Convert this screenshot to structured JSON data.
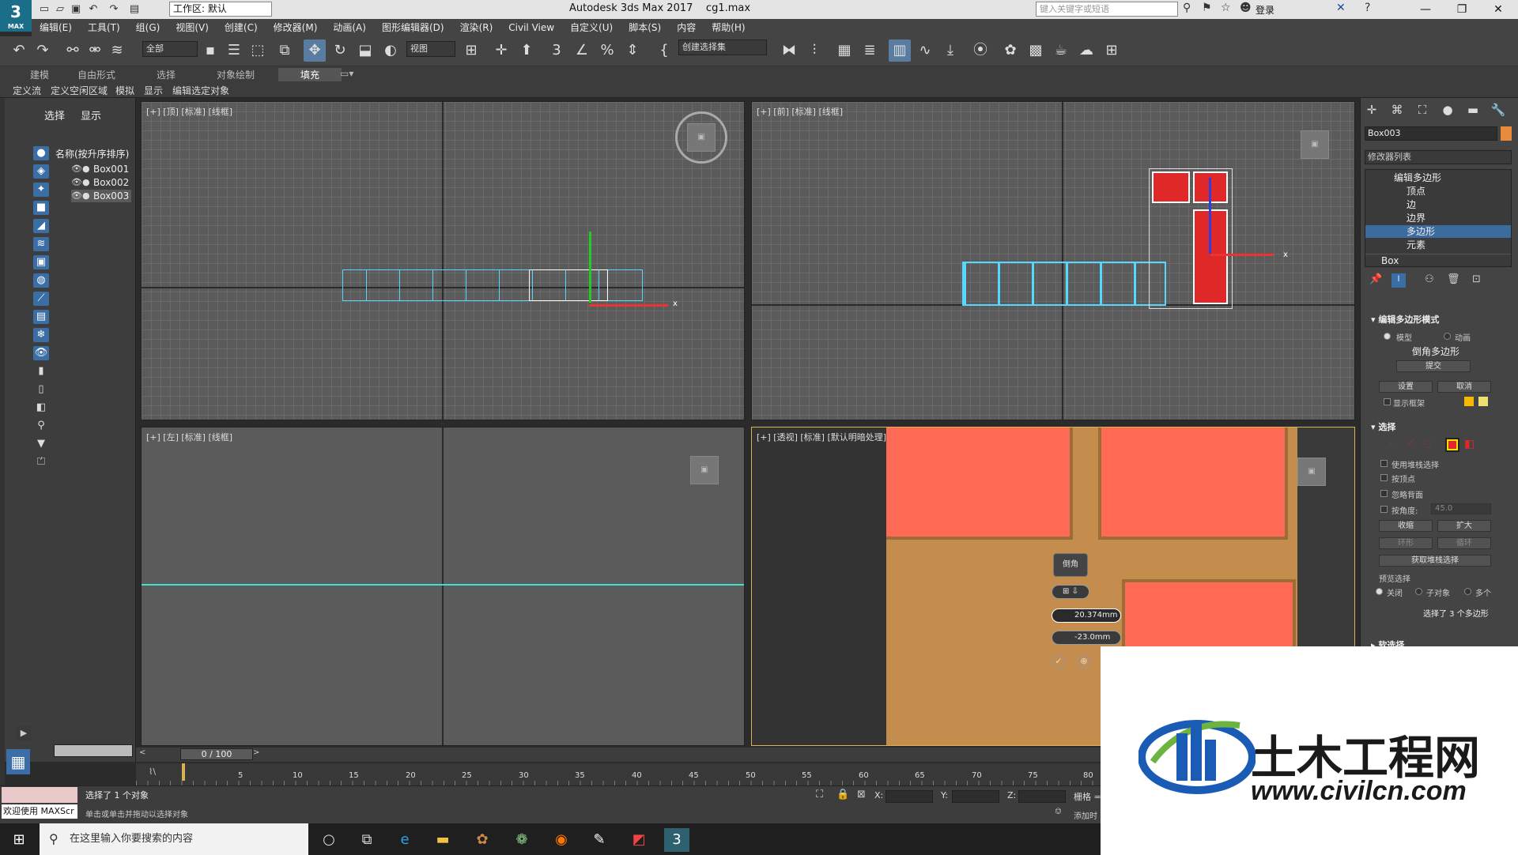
{
  "titlebar": {
    "logo": "3",
    "logo_sub": "MAX",
    "workspace": "工作区: 默认",
    "app": "Autodesk 3ds Max 2017",
    "file": "cg1.max",
    "search_placeholder": "键入关键字或短语",
    "login": "登录"
  },
  "menu": [
    "编辑(E)",
    "工具(T)",
    "组(G)",
    "视图(V)",
    "创建(C)",
    "修改器(M)",
    "动画(A)",
    "图形编辑器(D)",
    "渲染(R)",
    "Civil View",
    "自定义(U)",
    "脚本(S)",
    "内容",
    "帮助(H)"
  ],
  "toolbar": {
    "filter": "全部",
    "refcoord": "视图",
    "selset": "创建选择集"
  },
  "ribbon": {
    "tabs": [
      "建模",
      "自由形式",
      "选择",
      "对象绘制",
      "填充"
    ],
    "subtabs": [
      "定义流",
      "定义空闲区域",
      "模拟",
      "显示",
      "编辑选定对象"
    ]
  },
  "explorer": {
    "tabs": [
      "选择",
      "显示"
    ],
    "header": "名称(按升序排序)",
    "items": [
      "Box001",
      "Box002",
      "Box003"
    ]
  },
  "viewports": {
    "top": "[+] [顶] [标准] [线框]",
    "front": "[+] [前] [标准] [线框]",
    "left": "[+] [左] [标准] [线框]",
    "persp": "[+] [透视] [标准] [默认明暗处理]"
  },
  "caddy": {
    "title": "倒角",
    "height": "20.374mm",
    "outline": "-23.0mm"
  },
  "cmd": {
    "objname": "Box003",
    "modlist": "修改器列表",
    "stack": [
      "编辑多边形",
      "顶点",
      "边",
      "边界",
      "多边形",
      "元素",
      "Box"
    ],
    "roll1": "编辑多边形模式",
    "model": "模型",
    "anim": "动画",
    "bevel": "倒角多边形",
    "commit": "提交",
    "settings": "设置",
    "cancel": "取消",
    "showcage": "显示框架",
    "roll2": "选择",
    "bytvert": "使用堆栈选择",
    "byvert": "按顶点",
    "ignoreback": "忽略背面",
    "byangle": "按角度:",
    "angle": "45.0",
    "shrink": "收缩",
    "grow": "扩大",
    "ring": "环形",
    "loop": "循环",
    "getstack": "获取堆栈选择",
    "preview": "预览选择",
    "off": "关闭",
    "subobj": "子对象",
    "multi": "多个",
    "selcount": "选择了 3 个多边形",
    "roll3": "软选择"
  },
  "time": {
    "slider": "0 / 100",
    "ticks": [
      "5",
      "10",
      "15",
      "20",
      "25",
      "30",
      "35",
      "40",
      "45",
      "50",
      "55",
      "60",
      "65",
      "70",
      "75",
      "80"
    ]
  },
  "status": {
    "line1": "选择了 1 个对象",
    "line2": "单击或单击并拖动以选择对象",
    "welcome": "欢迎使用 MAXScr",
    "x": "X:",
    "y": "Y:",
    "z": "Z:",
    "grid": "栅格 =",
    "addtime": "添加时"
  },
  "taskbar": {
    "search": "在这里输入你要搜索的内容"
  },
  "watermark": {
    "cn": "土木工程网",
    "url": "www.civilcn.com"
  }
}
